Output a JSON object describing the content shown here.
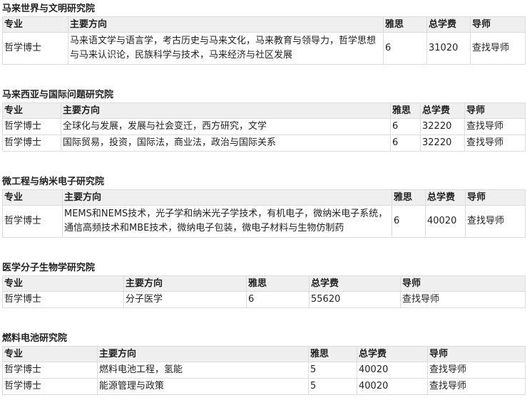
{
  "sections": [
    {
      "title": "马来世界与文明研究院",
      "headers": [
        "专业",
        "主要方向",
        "雅思",
        "总学费",
        "导师"
      ],
      "rows": [
        [
          "哲学博士",
          "马来语文学与语言学，考古历史与马来文化，马来教育与领导力，哲学思想与马来认识论，民族科学与技术，马来经济与社区发展",
          "6",
          "31020",
          "查找导师"
        ]
      ]
    },
    {
      "title": "马来西亚与国际问题研究院",
      "headers": [
        "专业",
        "主要方向",
        "雅思",
        "总学费",
        "导师"
      ],
      "rows": [
        [
          "哲学博士",
          "全球化与发展，发展与社会变迁，西方研究，文学",
          "6",
          "32220",
          "查找导师"
        ],
        [
          "哲学博士",
          "国际贸易，投资，国际法，商业法，政治与国际关系",
          "6",
          "32220",
          "查找导师"
        ]
      ]
    },
    {
      "title": "微工程与纳米电子研究院",
      "headers": [
        "专业",
        "主要方向",
        "雅思",
        "总学费",
        "导师"
      ],
      "rows": [
        [
          "哲学博士",
          "MEMS和NEMS技术，光子学和纳米光子学技术，有机电子，微纳米电子系统，通信高频技术和MBE技术，微纳电子包装，微电子材料与生物仿制药",
          "6",
          "40020",
          "查找导师"
        ]
      ]
    },
    {
      "title": "医学分子生物学研究院",
      "headers": [
        "专业",
        "主要方向",
        "雅思",
        "总学费",
        "导师"
      ],
      "rows": [
        [
          "哲学博士",
          "分子医学",
          "6",
          "55620",
          "查找导师"
        ]
      ]
    },
    {
      "title": "燃料电池研究院",
      "headers": [
        "专业",
        "主要方向",
        "雅思",
        "总学费",
        "导师"
      ],
      "rows": [
        [
          "哲学博士",
          "燃料电池工程，氢能",
          "5",
          "40020",
          "查找导师"
        ],
        [
          "哲学博士",
          "能源管理与政策",
          "5",
          "40020",
          "查找导师"
        ]
      ]
    }
  ]
}
